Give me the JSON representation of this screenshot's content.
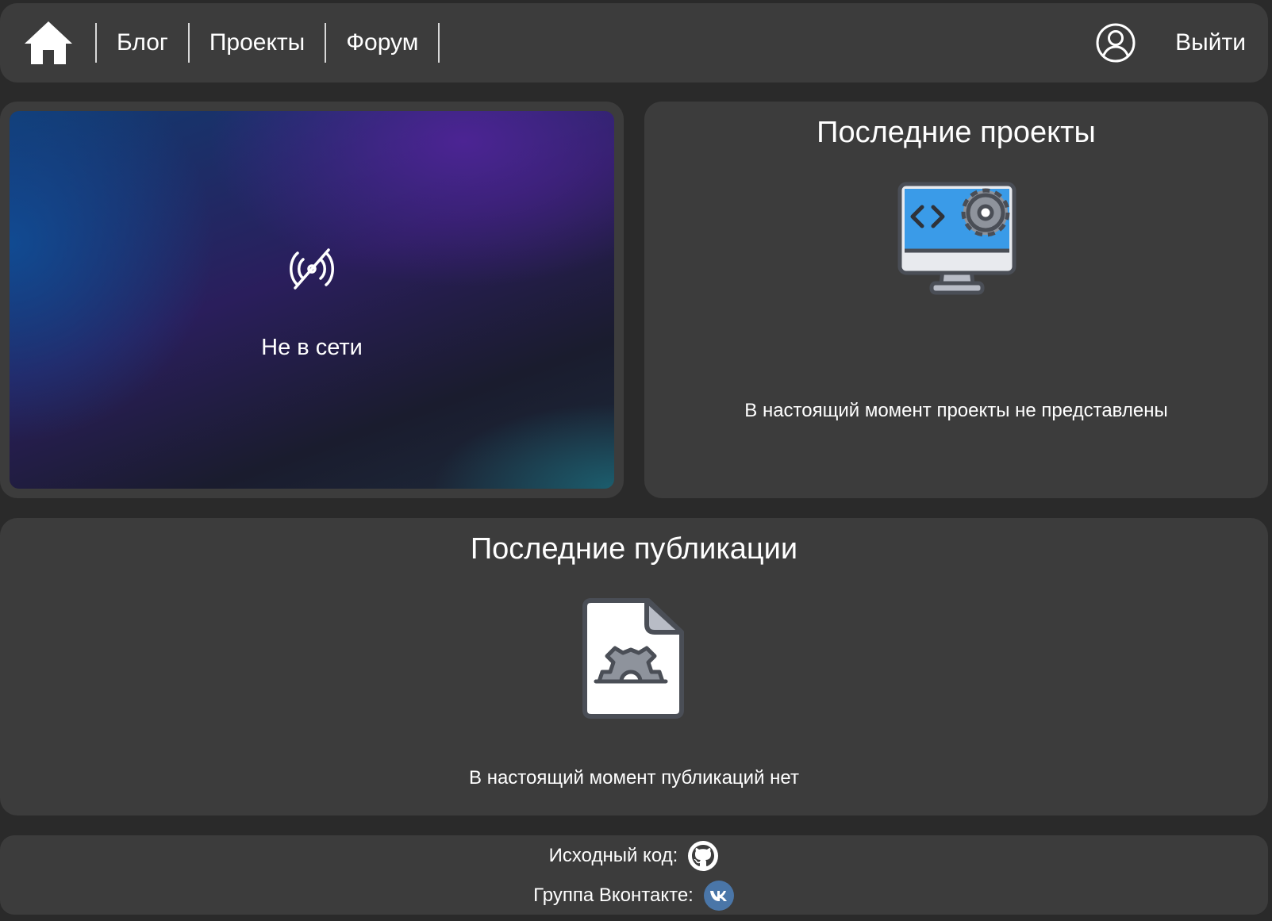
{
  "header": {
    "home_icon": "home-icon",
    "nav": [
      {
        "label": "Блог"
      },
      {
        "label": "Проекты"
      },
      {
        "label": "Форум"
      }
    ],
    "user_icon": "user-circle-icon",
    "logout_label": "Выйти"
  },
  "stream": {
    "status_icon": "broadcast-off-icon",
    "status_text": "Не в сети"
  },
  "projects": {
    "title": "Последние проекты",
    "icon": "monitor-code-gear-icon",
    "empty_text": "В настоящий момент проекты не представлены"
  },
  "publications": {
    "title": "Последние публикации",
    "icon": "document-gear-icon",
    "empty_text": "В настоящий момент публикаций нет"
  },
  "footer": {
    "source_label": "Исходный код:",
    "source_icon": "github-icon",
    "vk_label": "Группа Вконтакте:",
    "vk_icon": "vk-icon"
  },
  "colors": {
    "page_bg": "#2a2a2a",
    "panel_bg": "#3c3c3c",
    "text": "#ffffff",
    "icon_blue": "#3a9be8",
    "vk_blue": "#4a76a8"
  }
}
